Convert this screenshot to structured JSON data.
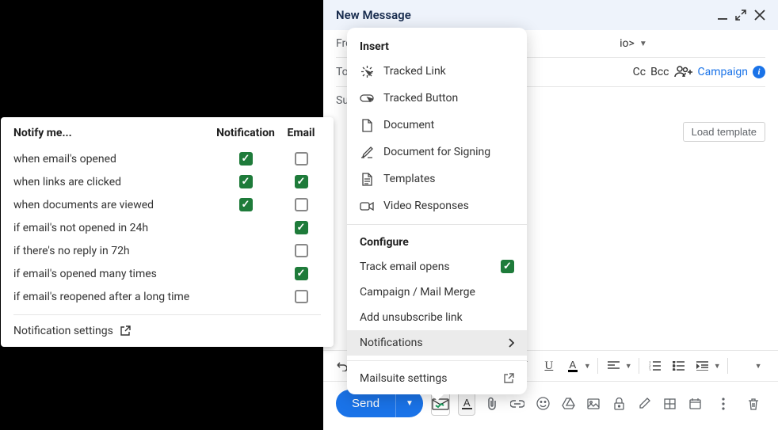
{
  "compose": {
    "title": "New Message",
    "from_label": "Fro",
    "from_value": "io>",
    "to_label": "To",
    "subject_label": "Su",
    "cc": "Cc",
    "bcc": "Bcc",
    "campaign": "Campaign",
    "load_template": "Load template",
    "send": "Send"
  },
  "insert_menu": {
    "insert_header": "Insert",
    "configure_header": "Configure",
    "items_insert": [
      {
        "label": "Tracked Link"
      },
      {
        "label": "Tracked Button"
      },
      {
        "label": "Document"
      },
      {
        "label": "Document for Signing"
      },
      {
        "label": "Templates"
      },
      {
        "label": "Video Responses"
      }
    ],
    "items_configure": [
      {
        "label": "Track email opens",
        "checked": true
      },
      {
        "label": "Campaign / Mail Merge"
      },
      {
        "label": "Add unsubscribe link"
      },
      {
        "label": "Notifications",
        "submenu": true,
        "selected": true
      }
    ],
    "mailsuite": "Mailsuite settings"
  },
  "notify": {
    "header": "Notify me...",
    "col_notification": "Notification",
    "col_email": "Email",
    "rows": [
      {
        "label": "when email's opened",
        "notif": true,
        "email": false
      },
      {
        "label": "when links are clicked",
        "notif": true,
        "email": true
      },
      {
        "label": "when documents are viewed",
        "notif": true,
        "email": false
      },
      {
        "label": "if email's not opened in 24h",
        "notif": false,
        "email": true,
        "hide_notif": true
      },
      {
        "label": "if there's no reply in 72h",
        "notif": false,
        "email": false,
        "hide_notif": true
      },
      {
        "label": "if email's opened many times",
        "notif": false,
        "email": true,
        "hide_notif": true
      },
      {
        "label": "if email's reopened after a long time",
        "notif": false,
        "email": false,
        "hide_notif": true
      }
    ],
    "settings": "Notification settings"
  }
}
